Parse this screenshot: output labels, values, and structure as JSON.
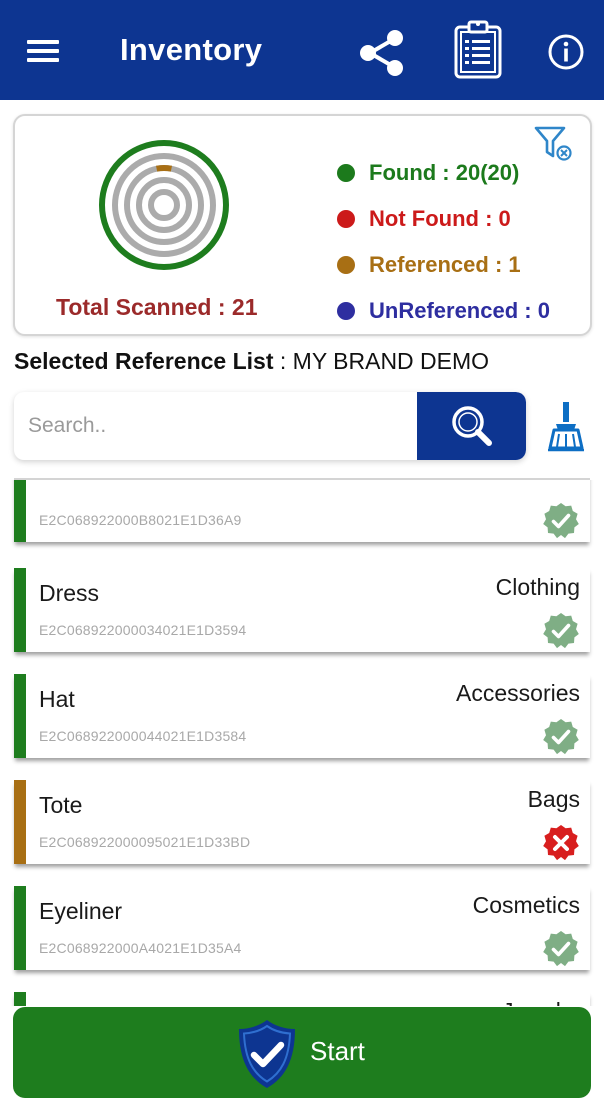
{
  "header": {
    "title": "Inventory",
    "menu_icon": "hamburger-menu-icon",
    "share_icon": "share-icon",
    "report_icon": "clipboard-icon",
    "info_icon": "info-icon"
  },
  "summary": {
    "total_label": "Total Scanned : 21",
    "legend": [
      {
        "key": "found",
        "label": "Found : 20(20)",
        "color": "#1c7a1c"
      },
      {
        "key": "not_found",
        "label": "Not Found : 0",
        "color": "#cc1a1a"
      },
      {
        "key": "referenced",
        "label": "Referenced : 1",
        "color": "#a86f14"
      },
      {
        "key": "unreferenced",
        "label": "UnReferenced : 0",
        "color": "#2e2ea0"
      }
    ],
    "filter_icon": "filter-clear-icon"
  },
  "reference": {
    "label": "Selected Reference List",
    "value": " : MY BRAND DEMO"
  },
  "search": {
    "placeholder": "Search..",
    "value": "",
    "search_icon": "magnifier-icon",
    "clear_icon": "broom-icon"
  },
  "items": [
    {
      "name": "",
      "category": "",
      "epc": "E2C068922000B8021E1D36A9",
      "status": "found",
      "bar_color": "#1e7d1e"
    },
    {
      "name": "Dress",
      "category": "Clothing",
      "epc": "E2C068922000034021E1D3594",
      "status": "found",
      "bar_color": "#1e7d1e"
    },
    {
      "name": "Hat",
      "category": "Accessories",
      "epc": "E2C068922000044021E1D3584",
      "status": "found",
      "bar_color": "#1e7d1e"
    },
    {
      "name": "Tote",
      "category": "Bags",
      "epc": "E2C068922000095021E1D33BD",
      "status": "error",
      "bar_color": "#a86f14"
    },
    {
      "name": "Eyeliner",
      "category": "Cosmetics",
      "epc": "E2C068922000A4021E1D35A4",
      "status": "found",
      "bar_color": "#1e7d1e"
    },
    {
      "name": "",
      "category": "Jewelry",
      "epc": "",
      "status": "found",
      "bar_color": "#1e7d1e"
    }
  ],
  "start": {
    "label": "Start",
    "icon": "shield-check-icon"
  },
  "colors": {
    "primary": "#0d3591",
    "success": "#1e7d1e",
    "check": "#7fae85",
    "error": "#d81e1e"
  }
}
